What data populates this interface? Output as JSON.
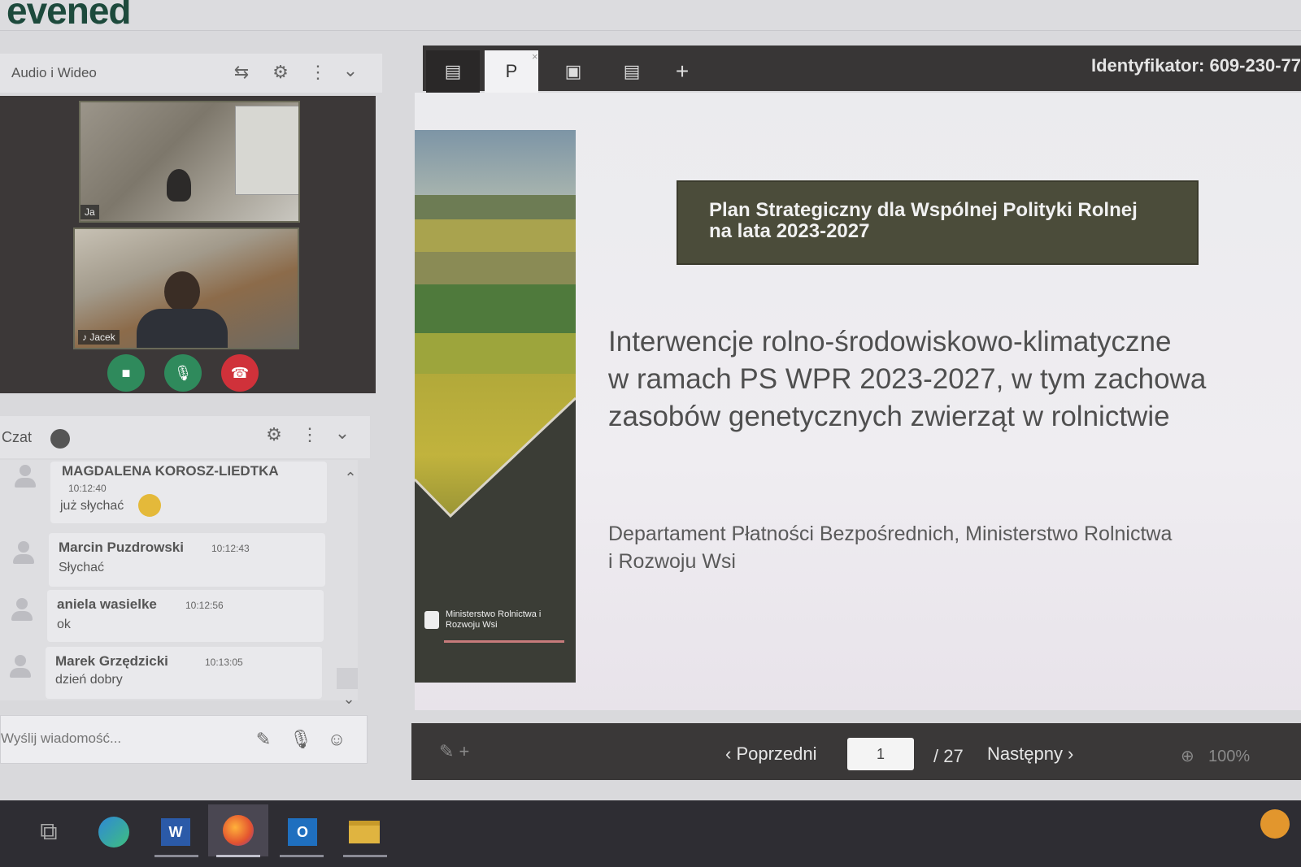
{
  "app": {
    "logo": "evened"
  },
  "audio_video": {
    "title": "Audio i Wideo",
    "tiles": [
      {
        "label": "Ja"
      },
      {
        "label": "Jacek"
      }
    ]
  },
  "chat": {
    "title": "Czat",
    "messages": [
      {
        "name": "MAGDALENA KOROSZ-LIEDTKA",
        "time": "10:12:40",
        "text": "już słychać"
      },
      {
        "name": "Marcin Puzdrowski",
        "time": "10:12:43",
        "text": "Słychać"
      },
      {
        "name": "aniela wasielke",
        "time": "10:12:56",
        "text": "ok"
      },
      {
        "name": "Marek Grzędzicki",
        "time": "10:13:05",
        "text": "dzień dobry"
      }
    ],
    "input_placeholder": "Wyślij wiadomość..."
  },
  "presentation": {
    "identifier": "Identyfikator: 609-230-77",
    "title_box": "Plan Strategiczny dla Wspólnej Polityki Rolnej na lata 2023-2027",
    "main_title": "Interwencje rolno-środowiskowo-klimatyczne\nw ramach PS WPR 2023-2027,  w tym zachowa\nzasobów genetycznych zwierząt w rolnictwie",
    "department": "Departament Płatności Bezpośrednich, Ministerstwo Rolnictwa\ni Rozwoju Wsi",
    "ministry_logo": "Ministerstwo Rolnictwa i Rozwoju Wsi"
  },
  "navigation": {
    "prev_label": "‹ Poprzedni",
    "page": "1",
    "total": "/ 27",
    "next_label": "Następny ›",
    "zoom": "100%"
  },
  "colors": {
    "toolbar": "#383636",
    "title_box": "#4b4c3a",
    "btn_video": "#2f8a5c",
    "btn_mic": "#2f8a5c",
    "btn_hangup": "#d0313a",
    "brand": "#1d4a3c"
  }
}
